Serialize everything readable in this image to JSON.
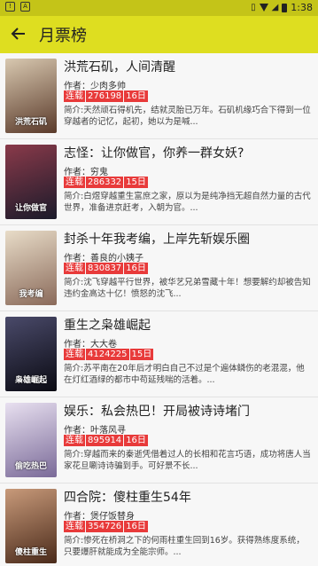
{
  "status_bar": {
    "time": "1:38",
    "left_icons": [
      "notification-icon",
      "app-icon"
    ]
  },
  "toolbar": {
    "title": "月票榜"
  },
  "books": [
    {
      "title": "洪荒石矶，人间清醒",
      "author": "作者：少肉多帅",
      "status": "连载",
      "count": "276198",
      "days": "16日",
      "intro": "简介:天然顽石得机先，结就灵胎已万年。石矶机缘巧合下得到一位穿越者的记忆，起初，她以为是喊...",
      "cover_color": "#5a3a2a",
      "cover_text": "洪荒石矶"
    },
    {
      "title": "志怪：让你做官，你养一群女妖?",
      "author": "作者：穷鬼",
      "status": "连载",
      "count": "286332",
      "days": "15日",
      "intro": "简介:白煜穿越重生富庶之家，原以为是纯净挡无超自然力量的古代世界，准备进京赶考，入朝为官。...",
      "cover_color": "#3a2a3a",
      "cover_text": "让你做官"
    },
    {
      "title": "封杀十年我考编，上岸先斩娱乐圈",
      "author": "作者：善良的小姨子",
      "status": "连载",
      "count": "830837",
      "days": "16日",
      "intro": "简介:沈飞穿越平行世界，被华艺兄弟雪藏十年！想要解约却被告知违约金高达十亿！愤怒的沈飞...",
      "cover_color": "#b8a48c",
      "cover_text": "我考编"
    },
    {
      "title": "重生之枭雄崛起",
      "author": "作者：大大卷",
      "status": "连载",
      "count": "4124225",
      "days": "15日",
      "intro": "简介:苏平南在20年后才明白自己不过是个遍体鳞伤的老混混，他在灯红酒绿的都市中苟延残喘的活着。...",
      "cover_color": "#1e1e2e",
      "cover_text": "枭雄崛起"
    },
    {
      "title": "娱乐：私会热巴！开局被诗诗堵门",
      "author": "作者：叶落风寻",
      "status": "连载",
      "count": "895914",
      "days": "16日",
      "intro": "简介:穿越而来的秦逝凭借着过人的长相和花言巧语，成功将唐人当家花旦唰诗诗骗到手。可好景不长...",
      "cover_color": "#9a8aa8",
      "cover_text": "偷吃热巴"
    },
    {
      "title": "四合院：傻柱重生54年",
      "author": "作者：煲仔饭替身",
      "status": "连载",
      "count": "354726",
      "days": "16日",
      "intro": "简介:惨死在桥洞之下的何雨柱重生回到16岁。获得熟练度系统，只要爆肝就能成为全能宗师。...",
      "cover_color": "#6a3a2a",
      "cover_text": "傻柱重生"
    }
  ]
}
